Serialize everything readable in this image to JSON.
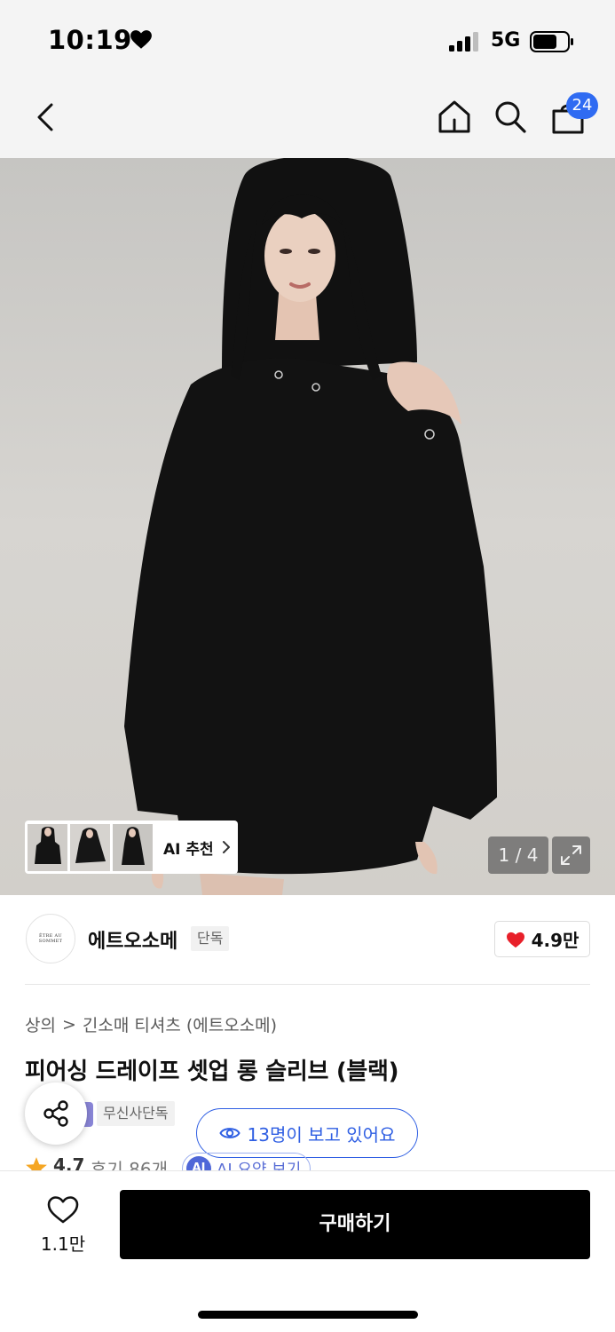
{
  "status_bar": {
    "time": "10:19",
    "network": "5G",
    "icons": [
      "heart-icon",
      "signal-icon",
      "battery-icon"
    ]
  },
  "nav": {
    "icons": [
      "back-icon",
      "home-icon",
      "search-icon",
      "shopping-bag-icon"
    ],
    "bag_badge": "24",
    "badge_color": "#2f6bf2"
  },
  "gallery": {
    "ai_recommend_label": "AI 추천",
    "page_counter": "1 / 4",
    "expand_icon": "expand-icon"
  },
  "brand": {
    "logo_text": "ÊTRE AU SOMMET",
    "name": "에트오소메",
    "tag": "단독",
    "like_count": "4.9만",
    "like_color": "#e8202a"
  },
  "product": {
    "breadcrumb": [
      "상의",
      "긴소매 티셔츠 (에트오소메)"
    ],
    "title": "피어싱 드레이프 셋업 롱 슬리브 (블랙)",
    "exclusive_tag": "무신사단독",
    "viewers_text": "13명이 보고 있어요",
    "viewers_color": "#2f5fe3",
    "rating": "4.7",
    "review_text": "후기 86개",
    "ai_summary_icon": "AI",
    "ai_summary_label": "AI 요약 보기"
  },
  "bottom_bar": {
    "wish_count": "1.1만",
    "buy_label": "구매하기"
  }
}
